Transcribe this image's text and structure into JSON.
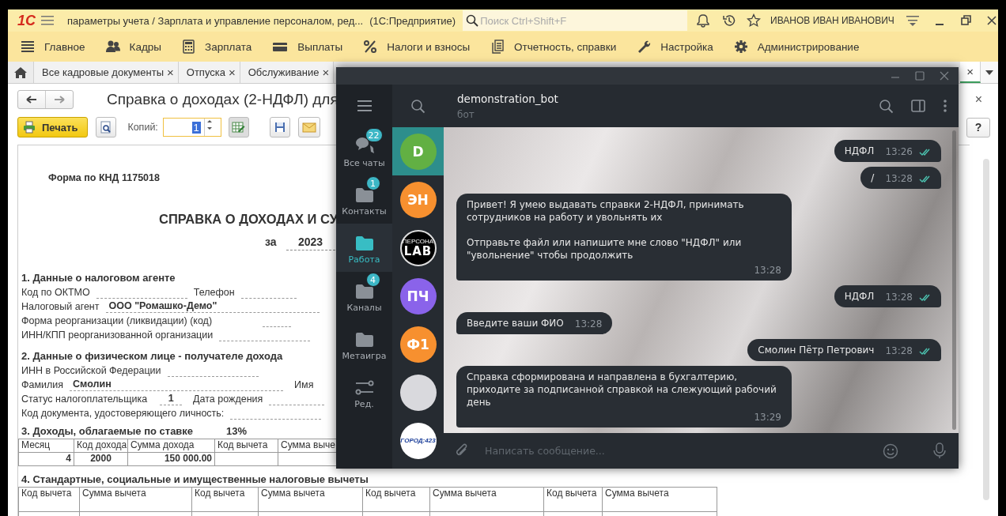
{
  "app": {
    "logo": "1С",
    "title": "параметры учета / Зарплата и управление персоналом, ред...",
    "product": "(1С:Предприятие)",
    "search": {
      "placeholder": "Поиск Ctrl+Shift+F"
    },
    "user": "ИВАНОВ ИВАН ИВАНОВИЧ"
  },
  "sections": [
    {
      "label": "Главное",
      "kind": "lines"
    },
    {
      "label": "Кадры",
      "kind": "people"
    },
    {
      "label": "Зарплата",
      "kind": "calculator"
    },
    {
      "label": "Выплаты",
      "kind": "card"
    },
    {
      "label": "Налоги и взносы",
      "kind": "percent"
    },
    {
      "label": "Отчетность, справки",
      "kind": "documents"
    },
    {
      "label": "Настройка",
      "kind": "wrench"
    },
    {
      "label": "Администрирование",
      "kind": "gear"
    }
  ],
  "tabs": [
    {
      "label": "Все кадровые документы",
      "close": "×",
      "selected": false
    },
    {
      "label": "Отпуска",
      "close": "×",
      "selected": false
    },
    {
      "label": "Обслуживание",
      "close": "×",
      "selected": false
    },
    {
      "close": "×",
      "selected": true
    }
  ],
  "form": {
    "title": "Справка о доходах (2-НДФЛ) для",
    "close": "×",
    "print": "Печать",
    "copies_label": "Копий:",
    "copies_value": "1",
    "help": "?"
  },
  "document": {
    "form_code": "Форма по КНД 1175018",
    "heading": "СПРАВКА О ДОХОДАХ И СУ",
    "year_label": "за",
    "year": "2023",
    "sections": [
      {
        "title": "1. Данные о налоговом агенте",
        "lines": [
          [
            {
              "kind": "label",
              "text": "Код по ОКТМО"
            },
            {
              "kind": "blank"
            },
            {
              "kind": "label",
              "text": "Телефон"
            },
            {
              "kind": "blank"
            }
          ],
          [
            {
              "kind": "label",
              "text": "Налоговый агент"
            },
            {
              "kind": "value",
              "text": "ООО \"Ромашко-Демо\""
            }
          ],
          [
            {
              "kind": "label",
              "text": "Форма реорганизации (ликвидации)  (код)"
            },
            {
              "kind": "short_blank"
            }
          ],
          [
            {
              "kind": "label",
              "text": "ИНН/КПП  реорганизованной организации"
            },
            {
              "kind": "blank"
            }
          ]
        ]
      },
      {
        "title": "2. Данные о физическом лице - получателе дохода",
        "lines": [
          [
            {
              "kind": "label",
              "text": "ИНН в Российской Федерации"
            },
            {
              "kind": "blank"
            }
          ],
          [
            {
              "kind": "label",
              "text": "Фамилия"
            },
            {
              "kind": "value",
              "text": "Смолин"
            },
            {
              "kind": "label",
              "text": "Имя"
            }
          ],
          [
            {
              "kind": "label",
              "text": "Статус налогоплательщика"
            },
            {
              "kind": "code",
              "text": "1"
            },
            {
              "kind": "label",
              "text": "Дата рождения"
            },
            {
              "kind": "blank"
            }
          ],
          [
            {
              "kind": "label",
              "text": "Код документа, удостоверяющего личность:"
            },
            {
              "kind": "blank"
            }
          ]
        ]
      },
      {
        "title": "3. Доходы, облагаемые по ставке",
        "rate": "13%",
        "table": {
          "columns": [
            "Месяц",
            "Код дохода",
            "Сумма дохода",
            "Код вычета",
            "Сумма выче"
          ],
          "rows": [
            {
              "cells": [
                "4",
                "2000",
                "150 000.00"
              ]
            }
          ]
        }
      },
      {
        "title": "4. Стандартные, социальные и имущественные налоговые вычеты",
        "table": {
          "columns": [
            "Код вычета",
            "Сумма вычета",
            "Код вычета",
            "Сумма вычета",
            "Код вычета",
            "Сумма вычета",
            "Код вычета",
            "Сумма вычета"
          ]
        }
      }
    ]
  },
  "messenger": {
    "folders": [
      {
        "label": "Все чаты",
        "kind": "chats",
        "badge": "22",
        "selected": false
      },
      {
        "label": "Контакты",
        "kind": "folder",
        "badge": "1",
        "selected": false
      },
      {
        "label": "Работа",
        "kind": "folder",
        "selected": true
      },
      {
        "label": "Каналы",
        "kind": "folder",
        "badge": "4",
        "selected": false
      },
      {
        "label": "Метаигра",
        "kind": "folder",
        "selected": false
      },
      {
        "label": "Ред.",
        "kind": "sliders",
        "selected": false
      }
    ],
    "chats": [
      {
        "kind": "initials",
        "initials": "D",
        "color": "#62b043",
        "selected": true
      },
      {
        "kind": "initials",
        "initials": "ЭН",
        "color": "#f7902f",
        "selected": false
      },
      {
        "kind": "logo",
        "lines": [
          "ПЕРСОНА",
          "LAB"
        ],
        "selected": false
      },
      {
        "kind": "initials",
        "initials": "ПЧ",
        "color": "#8a63ea",
        "selected": false
      },
      {
        "kind": "initials",
        "initials": "Ф1",
        "color": "#f7902f",
        "selected": false
      },
      {
        "kind": "photo",
        "selected": false
      },
      {
        "kind": "badge_logo",
        "lines": [
          "ГОРОД:423"
        ],
        "selected": false
      }
    ],
    "chat": {
      "name": "demonstration_bot",
      "status": "бот",
      "input": {
        "placeholder": "Написать сообщение..."
      },
      "messages": [
        {
          "kind": "out",
          "text": "НДФЛ",
          "time": "13:26",
          "read": true
        },
        {
          "kind": "out",
          "text": "/",
          "time": "13:28",
          "read": true
        },
        {
          "kind": "in",
          "text": "Привет! Я умею выдавать справки 2-НДФЛ, принимать сотрудников на работу и увольнять их\n\nОтправьте файл или напишите мне слово \"НДФЛ\" или \"увольнение\" чтобы продолжить",
          "time": "13:28"
        },
        {
          "kind": "out",
          "text": "НДФЛ",
          "time": "13:28",
          "read": true
        },
        {
          "kind": "in",
          "text": "Введите ваши ФИО",
          "time": "13:28"
        },
        {
          "kind": "out",
          "text": "Смолин Пётр Петрович",
          "time": "13:28",
          "read": true
        },
        {
          "kind": "in",
          "text": "Справка сформирована и направлена в бухгалтерию, приходите за подписанной справкой на слежующий рабочий день",
          "time": "13:29"
        }
      ]
    }
  }
}
